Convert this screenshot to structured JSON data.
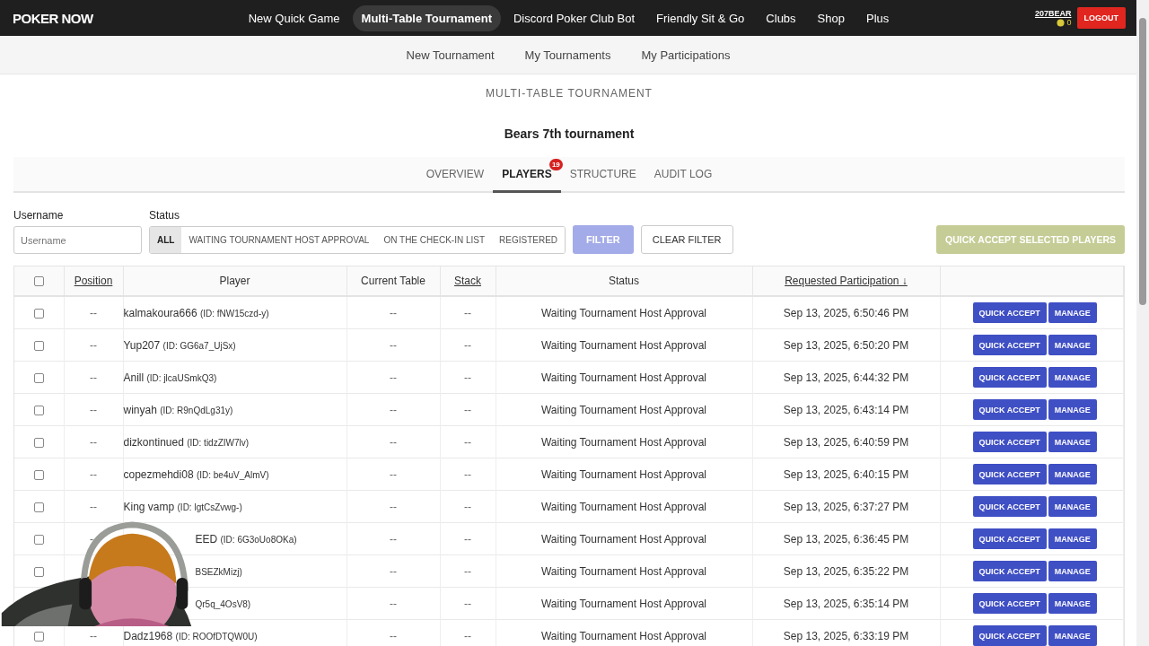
{
  "topbar": {
    "logo": "POKER NOW",
    "nav": [
      {
        "label": "New Quick Game",
        "selected": false
      },
      {
        "label": "Multi-Table Tournament",
        "selected": true
      },
      {
        "label": "Discord Poker Club Bot",
        "selected": false
      },
      {
        "label": "Friendly Sit & Go",
        "selected": false
      },
      {
        "label": "Clubs",
        "selected": false
      },
      {
        "label": "Shop",
        "selected": false
      },
      {
        "label": "Plus",
        "selected": false
      }
    ],
    "user": "207BEAR",
    "coins": "0",
    "logout": "LOGOUT"
  },
  "subnav": [
    "New Tournament",
    "My Tournaments",
    "My Participations"
  ],
  "section_title": "MULTI-TABLE TOURNAMENT",
  "tournament_name": "Bears 7th tournament",
  "tabs": [
    {
      "label": "OVERVIEW",
      "selected": false
    },
    {
      "label": "PLAYERS",
      "selected": true,
      "badge": "19"
    },
    {
      "label": "STRUCTURE",
      "selected": false
    },
    {
      "label": "AUDIT LOG",
      "selected": false
    }
  ],
  "filters": {
    "username_label": "Username",
    "username_placeholder": "Username",
    "status_label": "Status",
    "status_options": [
      {
        "label": "ALL",
        "selected": true
      },
      {
        "label": "WAITING TOURNAMENT HOST APPROVAL",
        "selected": false
      },
      {
        "label": "ON THE CHECK-IN LIST",
        "selected": false
      },
      {
        "label": "REGISTERED",
        "selected": false
      }
    ],
    "filter_button": {
      "label": "FILTER",
      "disabled": true
    },
    "clear_button": "CLEAR FILTER",
    "quick_accept_selected": {
      "label": "QUICK ACCEPT SELECTED PLAYERS",
      "disabled": true
    }
  },
  "table": {
    "select_all_checked": false,
    "columns": [
      {
        "label": "Position",
        "sortable": true
      },
      {
        "label": "Player",
        "sortable": false
      },
      {
        "label": "Current Table",
        "sortable": false
      },
      {
        "label": "Stack",
        "sortable": true
      },
      {
        "label": "Status",
        "sortable": false
      },
      {
        "label": "Requested Participation ↓",
        "sortable": true
      }
    ],
    "rows": [
      {
        "checked": false,
        "position": "--",
        "name": "kalmakoura666",
        "id": "(ID: fNW15czd-y)",
        "table": "--",
        "stack": "--",
        "status": "Waiting Tournament Host Approval",
        "requested": "Sep 13, 2025, 6:50:46 PM",
        "accept": "QUICK ACCEPT",
        "manage": "MANAGE"
      },
      {
        "checked": false,
        "position": "--",
        "name": "Yup207",
        "id": "(ID: GG6a7_UjSx)",
        "table": "--",
        "stack": "--",
        "status": "Waiting Tournament Host Approval",
        "requested": "Sep 13, 2025, 6:50:20 PM",
        "accept": "QUICK ACCEPT",
        "manage": "MANAGE"
      },
      {
        "checked": false,
        "position": "--",
        "name": "Anill",
        "id": "(ID: jlcaUSmkQ3)",
        "table": "--",
        "stack": "--",
        "status": "Waiting Tournament Host Approval",
        "requested": "Sep 13, 2025, 6:44:32 PM",
        "accept": "QUICK ACCEPT",
        "manage": "MANAGE"
      },
      {
        "checked": false,
        "position": "--",
        "name": "winyah",
        "id": "(ID: R9nQdLg31y)",
        "table": "--",
        "stack": "--",
        "status": "Waiting Tournament Host Approval",
        "requested": "Sep 13, 2025, 6:43:14 PM",
        "accept": "QUICK ACCEPT",
        "manage": "MANAGE"
      },
      {
        "checked": false,
        "position": "--",
        "name": "dizkontinued",
        "id": "(ID: tidzZIW7lv)",
        "table": "--",
        "stack": "--",
        "status": "Waiting Tournament Host Approval",
        "requested": "Sep 13, 2025, 6:40:59 PM",
        "accept": "QUICK ACCEPT",
        "manage": "MANAGE"
      },
      {
        "checked": false,
        "position": "--",
        "name": "copezmehdi08",
        "id": "(ID: be4uV_AlmV)",
        "table": "--",
        "stack": "--",
        "status": "Waiting Tournament Host Approval",
        "requested": "Sep 13, 2025, 6:40:15 PM",
        "accept": "QUICK ACCEPT",
        "manage": "MANAGE"
      },
      {
        "checked": false,
        "position": "--",
        "name": "King vamp",
        "id": "(ID: lgtCsZvwg-)",
        "table": "--",
        "stack": "--",
        "status": "Waiting Tournament Host Approval",
        "requested": "Sep 13, 2025, 6:37:27 PM",
        "accept": "QUICK ACCEPT",
        "manage": "MANAGE"
      },
      {
        "checked": false,
        "position": "--",
        "covered": true,
        "name": "EED",
        "id": "(ID: 6G3oUo8OKa)",
        "table": "--",
        "stack": "--",
        "status": "Waiting Tournament Host Approval",
        "requested": "Sep 13, 2025, 6:36:45 PM",
        "accept": "QUICK ACCEPT",
        "manage": "MANAGE"
      },
      {
        "checked": false,
        "covered": true,
        "id": "BSEZkMizj)",
        "table": "--",
        "stack": "--",
        "status": "Waiting Tournament Host Approval",
        "requested": "Sep 13, 2025, 6:35:22 PM",
        "accept": "QUICK ACCEPT",
        "manage": "MANAGE"
      },
      {
        "covered": true,
        "id": "Qr5q_4OsV8)",
        "table": "--",
        "stack": "--",
        "status": "Waiting Tournament Host Approval",
        "requested": "Sep 13, 2025, 6:35:14 PM",
        "accept": "QUICK ACCEPT",
        "manage": "MANAGE"
      },
      {
        "checked": false,
        "position": "--",
        "name": "Dadz1968",
        "id": "(ID: ROOfDTQW0U)",
        "table": "--",
        "stack": "--",
        "status": "Waiting Tournament Host Approval",
        "requested": "Sep 13, 2025, 6:33:19 PM",
        "accept": "QUICK ACCEPT",
        "manage": "MANAGE"
      }
    ]
  },
  "webcam": {
    "kind": "picture"
  }
}
